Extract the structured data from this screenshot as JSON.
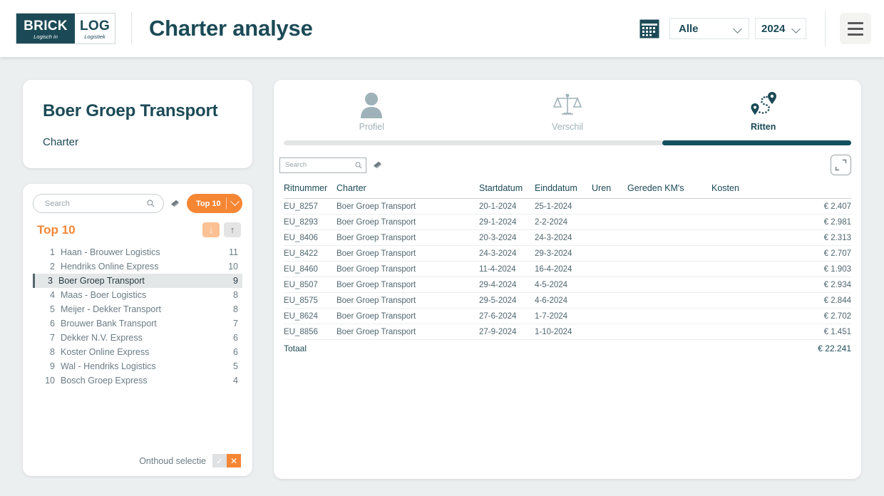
{
  "header": {
    "logo": {
      "brick": "BRICK",
      "log": "LOG",
      "tagline_left": "Logisch in",
      "tagline_right": "Logistiek"
    },
    "title": "Charter analyse",
    "calendar_icon": "calendar-icon",
    "filter_select": {
      "value": "Alle"
    },
    "year_select": {
      "value": "2024"
    },
    "menu_icon": "hamburger-menu-icon"
  },
  "entity_card": {
    "name": "Boer Groep Transport",
    "subtitle": "Charter"
  },
  "ranking_panel": {
    "search": {
      "placeholder": "Search",
      "value": ""
    },
    "search_icon": "search-icon",
    "eraser_icon": "eraser-icon",
    "top_button": {
      "label": "Top 10"
    },
    "title": "Top 10",
    "sort_desc_icon": "arrow-down-icon",
    "sort_asc_icon": "arrow-up-icon",
    "items": [
      {
        "rank": "1",
        "name": "Haan - Brouwer Logistics",
        "value": "11",
        "selected": false
      },
      {
        "rank": "2",
        "name": "Hendriks Online Express",
        "value": "10",
        "selected": false
      },
      {
        "rank": "3",
        "name": "Boer Groep Transport",
        "value": "9",
        "selected": true
      },
      {
        "rank": "4",
        "name": "Maas - Boer Logistics",
        "value": "8",
        "selected": false
      },
      {
        "rank": "5",
        "name": "Meijer - Dekker Transport",
        "value": "8",
        "selected": false
      },
      {
        "rank": "6",
        "name": "Brouwer Bank Transport",
        "value": "7",
        "selected": false
      },
      {
        "rank": "7",
        "name": "Dekker N.V. Express",
        "value": "6",
        "selected": false
      },
      {
        "rank": "8",
        "name": "Koster Online Express",
        "value": "6",
        "selected": false
      },
      {
        "rank": "9",
        "name": "Wal - Hendriks Logistics",
        "value": "5",
        "selected": false
      },
      {
        "rank": "10",
        "name": "Bosch Groep Express",
        "value": "4",
        "selected": false
      }
    ],
    "footer": {
      "label": "Onthoud selectie",
      "confirm_icon": "check-icon",
      "clear_icon": "cross-icon"
    }
  },
  "detail_panel": {
    "tabs": [
      {
        "label": "Profiel",
        "icon": "person-icon",
        "active": false
      },
      {
        "label": "Verschil",
        "icon": "scales-icon",
        "active": false
      },
      {
        "label": "Ritten",
        "icon": "route-pin-icon",
        "active": true
      }
    ],
    "search": {
      "placeholder": "Search",
      "value": ""
    },
    "search_icon": "search-icon",
    "eraser_icon": "eraser-icon",
    "expand_icon": "expand-icon",
    "table": {
      "columns": [
        "Ritnummer",
        "Charter",
        "Startdatum",
        "Einddatum",
        "Uren",
        "Gereden KM's",
        "Kosten"
      ],
      "rows": [
        {
          "ritnummer": "EU_8257",
          "charter": "Boer Groep Transport",
          "startdatum": "20-1-2024",
          "einddatum": "25-1-2024",
          "uren": "",
          "km": "",
          "kosten": "€ 2.407"
        },
        {
          "ritnummer": "EU_8293",
          "charter": "Boer Groep Transport",
          "startdatum": "29-1-2024",
          "einddatum": "2-2-2024",
          "uren": "",
          "km": "",
          "kosten": "€ 2.981"
        },
        {
          "ritnummer": "EU_8406",
          "charter": "Boer Groep Transport",
          "startdatum": "20-3-2024",
          "einddatum": "24-3-2024",
          "uren": "",
          "km": "",
          "kosten": "€ 2.313"
        },
        {
          "ritnummer": "EU_8422",
          "charter": "Boer Groep Transport",
          "startdatum": "24-3-2024",
          "einddatum": "29-3-2024",
          "uren": "",
          "km": "",
          "kosten": "€ 2.707"
        },
        {
          "ritnummer": "EU_8460",
          "charter": "Boer Groep Transport",
          "startdatum": "11-4-2024",
          "einddatum": "16-4-2024",
          "uren": "",
          "km": "",
          "kosten": "€ 1.903"
        },
        {
          "ritnummer": "EU_8507",
          "charter": "Boer Groep Transport",
          "startdatum": "29-4-2024",
          "einddatum": "4-5-2024",
          "uren": "",
          "km": "",
          "kosten": "€ 2.934"
        },
        {
          "ritnummer": "EU_8575",
          "charter": "Boer Groep Transport",
          "startdatum": "29-5-2024",
          "einddatum": "4-6-2024",
          "uren": "",
          "km": "",
          "kosten": "€ 2.844"
        },
        {
          "ritnummer": "EU_8624",
          "charter": "Boer Groep Transport",
          "startdatum": "27-6-2024",
          "einddatum": "1-7-2024",
          "uren": "",
          "km": "",
          "kosten": "€ 2.702"
        },
        {
          "ritnummer": "EU_8856",
          "charter": "Boer Groep Transport",
          "startdatum": "27-9-2024",
          "einddatum": "1-10-2024",
          "uren": "",
          "km": "",
          "kosten": "€ 1.451"
        }
      ],
      "total": {
        "label": "Totaal",
        "kosten": "€ 22.241"
      }
    }
  },
  "colors": {
    "brand_dark": "#1b4a56",
    "accent_orange": "#f58634",
    "tab_active": "#13505e",
    "page_background": "#eceff0",
    "text_muted": "#6b7c85"
  }
}
